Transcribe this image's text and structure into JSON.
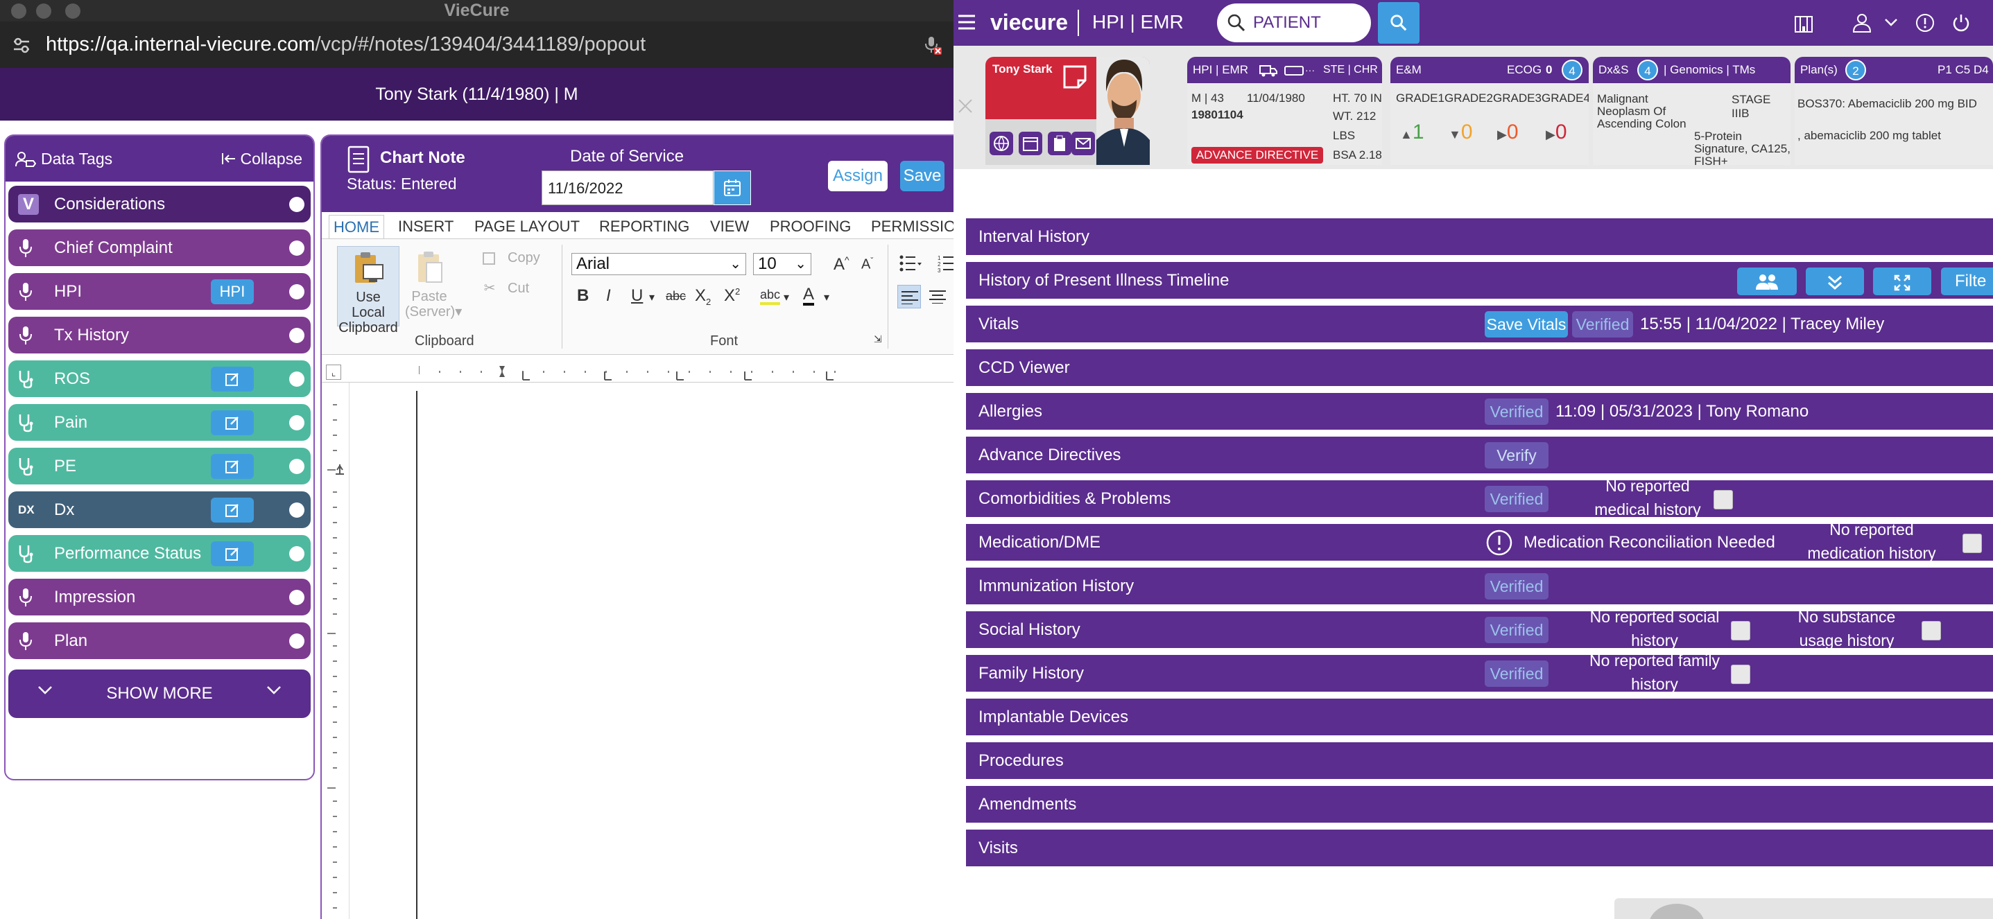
{
  "window": {
    "title": "VieCure",
    "url_host": "https://qa.internal-viecure.com",
    "url_path": "/vcp/#/notes/139404/3441189/popout"
  },
  "patient_bar": "Tony Stark (11/4/1980) | M",
  "data_tags": {
    "title": "Data Tags",
    "collapse": "Collapse",
    "items": [
      {
        "label": "Considerations"
      },
      {
        "label": "Chief Complaint"
      },
      {
        "label": "HPI",
        "button": "HPI"
      },
      {
        "label": "Tx History"
      },
      {
        "label": "ROS"
      },
      {
        "label": "Pain"
      },
      {
        "label": "PE"
      },
      {
        "label": "Dx",
        "prefix": "DX"
      },
      {
        "label": "Performance Status"
      },
      {
        "label": "Impression"
      },
      {
        "label": "Plan"
      }
    ],
    "show_more": "SHOW MORE"
  },
  "chart_note": {
    "title": "Chart Note",
    "status": "Status: Entered",
    "dos_label": "Date of Service",
    "dos_value": "11/16/2022",
    "assign": "Assign",
    "save": "Save"
  },
  "ribbon": {
    "tabs": [
      "HOME",
      "INSERT",
      "PAGE LAYOUT",
      "REPORTING",
      "VIEW",
      "PROOFING",
      "PERMISSIO"
    ],
    "use_local_1": "Use Local",
    "use_local_2": "Clipboard",
    "paste_1": "Paste",
    "paste_2": "(Server)▾",
    "copy": "Copy",
    "cut": "Cut",
    "clipboard_group": "Clipboard",
    "font_group": "Font",
    "font_name": "Arial",
    "font_size": "10"
  },
  "emr": {
    "brand": "viecure",
    "product": "HPI | EMR",
    "search_placeholder": "PATIENT SEARCH"
  },
  "cards": {
    "patient": {
      "name": "Tony Stark",
      "hdr_left": "HPI | EMR",
      "hdr_right": "STE | CHR",
      "age": "M | 43",
      "dob": "11/04/1980",
      "mrn": "19801104",
      "ht": "HT. 70 IN",
      "wt": "WT. 212",
      "lbs": "LBS",
      "bsa": "BSA 2.18",
      "advance": "ADVANCE DIRECTIVE"
    },
    "em": {
      "title": "E&M",
      "ecog": "ECOG",
      "ecog_val": "0",
      "badge": "4",
      "grades": [
        "GRADE1",
        "GRADE2",
        "GRADE3",
        "GRADE4"
      ],
      "values": [
        "1",
        "0",
        "0",
        "0"
      ]
    },
    "dx": {
      "title": "Dx&S",
      "badge": "4",
      "title2": "| Genomics | TMs",
      "dx1": "Malignant",
      "dx2": "Neoplasm Of",
      "dx3": "Ascending Colon",
      "stage": "STAGE IIIB",
      "tm1": "5-Protein",
      "tm2": "Signature, CA125,",
      "tm3": "FISH+"
    },
    "plan": {
      "title": "Plan(s)",
      "badge": "2",
      "code": "P1 C5 D4",
      "line1": "BOS370: Abemaciclib 200 mg BID",
      "line2": ", abemaciclib 200 mg tablet"
    }
  },
  "sections": {
    "interval": "Interval History",
    "hpi_timeline": "History of Present Illness Timeline",
    "filter": "Filte",
    "vitals": "Vitals",
    "save_vitals": "Save Vitals",
    "verified": "Verified",
    "vitals_info": "15:55 | 11/04/2022 | Tracey Miley",
    "ccd": "CCD Viewer",
    "allergies": "Allergies",
    "allergies_info": "11:09 | 05/31/2023 | Tony Romano",
    "advance": "Advance Directives",
    "verify": "Verify",
    "comorb": "Comorbidities & Problems",
    "no_medical_1": "No reported",
    "no_medical_2": "medical history",
    "medication": "Medication/DME",
    "med_recon": "Medication Reconciliation Needed",
    "no_med_1": "No reported",
    "no_med_2": "medication history",
    "immun": "Immunization History",
    "social": "Social History",
    "no_social_1": "No reported social",
    "no_social_2": "history",
    "no_subst_1": "No substance",
    "no_subst_2": "usage history",
    "family": "Family History",
    "no_family_1": "No reported family",
    "no_family_2": "history",
    "implant": "Implantable Devices",
    "procedures": "Procedures",
    "amendments": "Amendments",
    "visits": "Visits"
  }
}
